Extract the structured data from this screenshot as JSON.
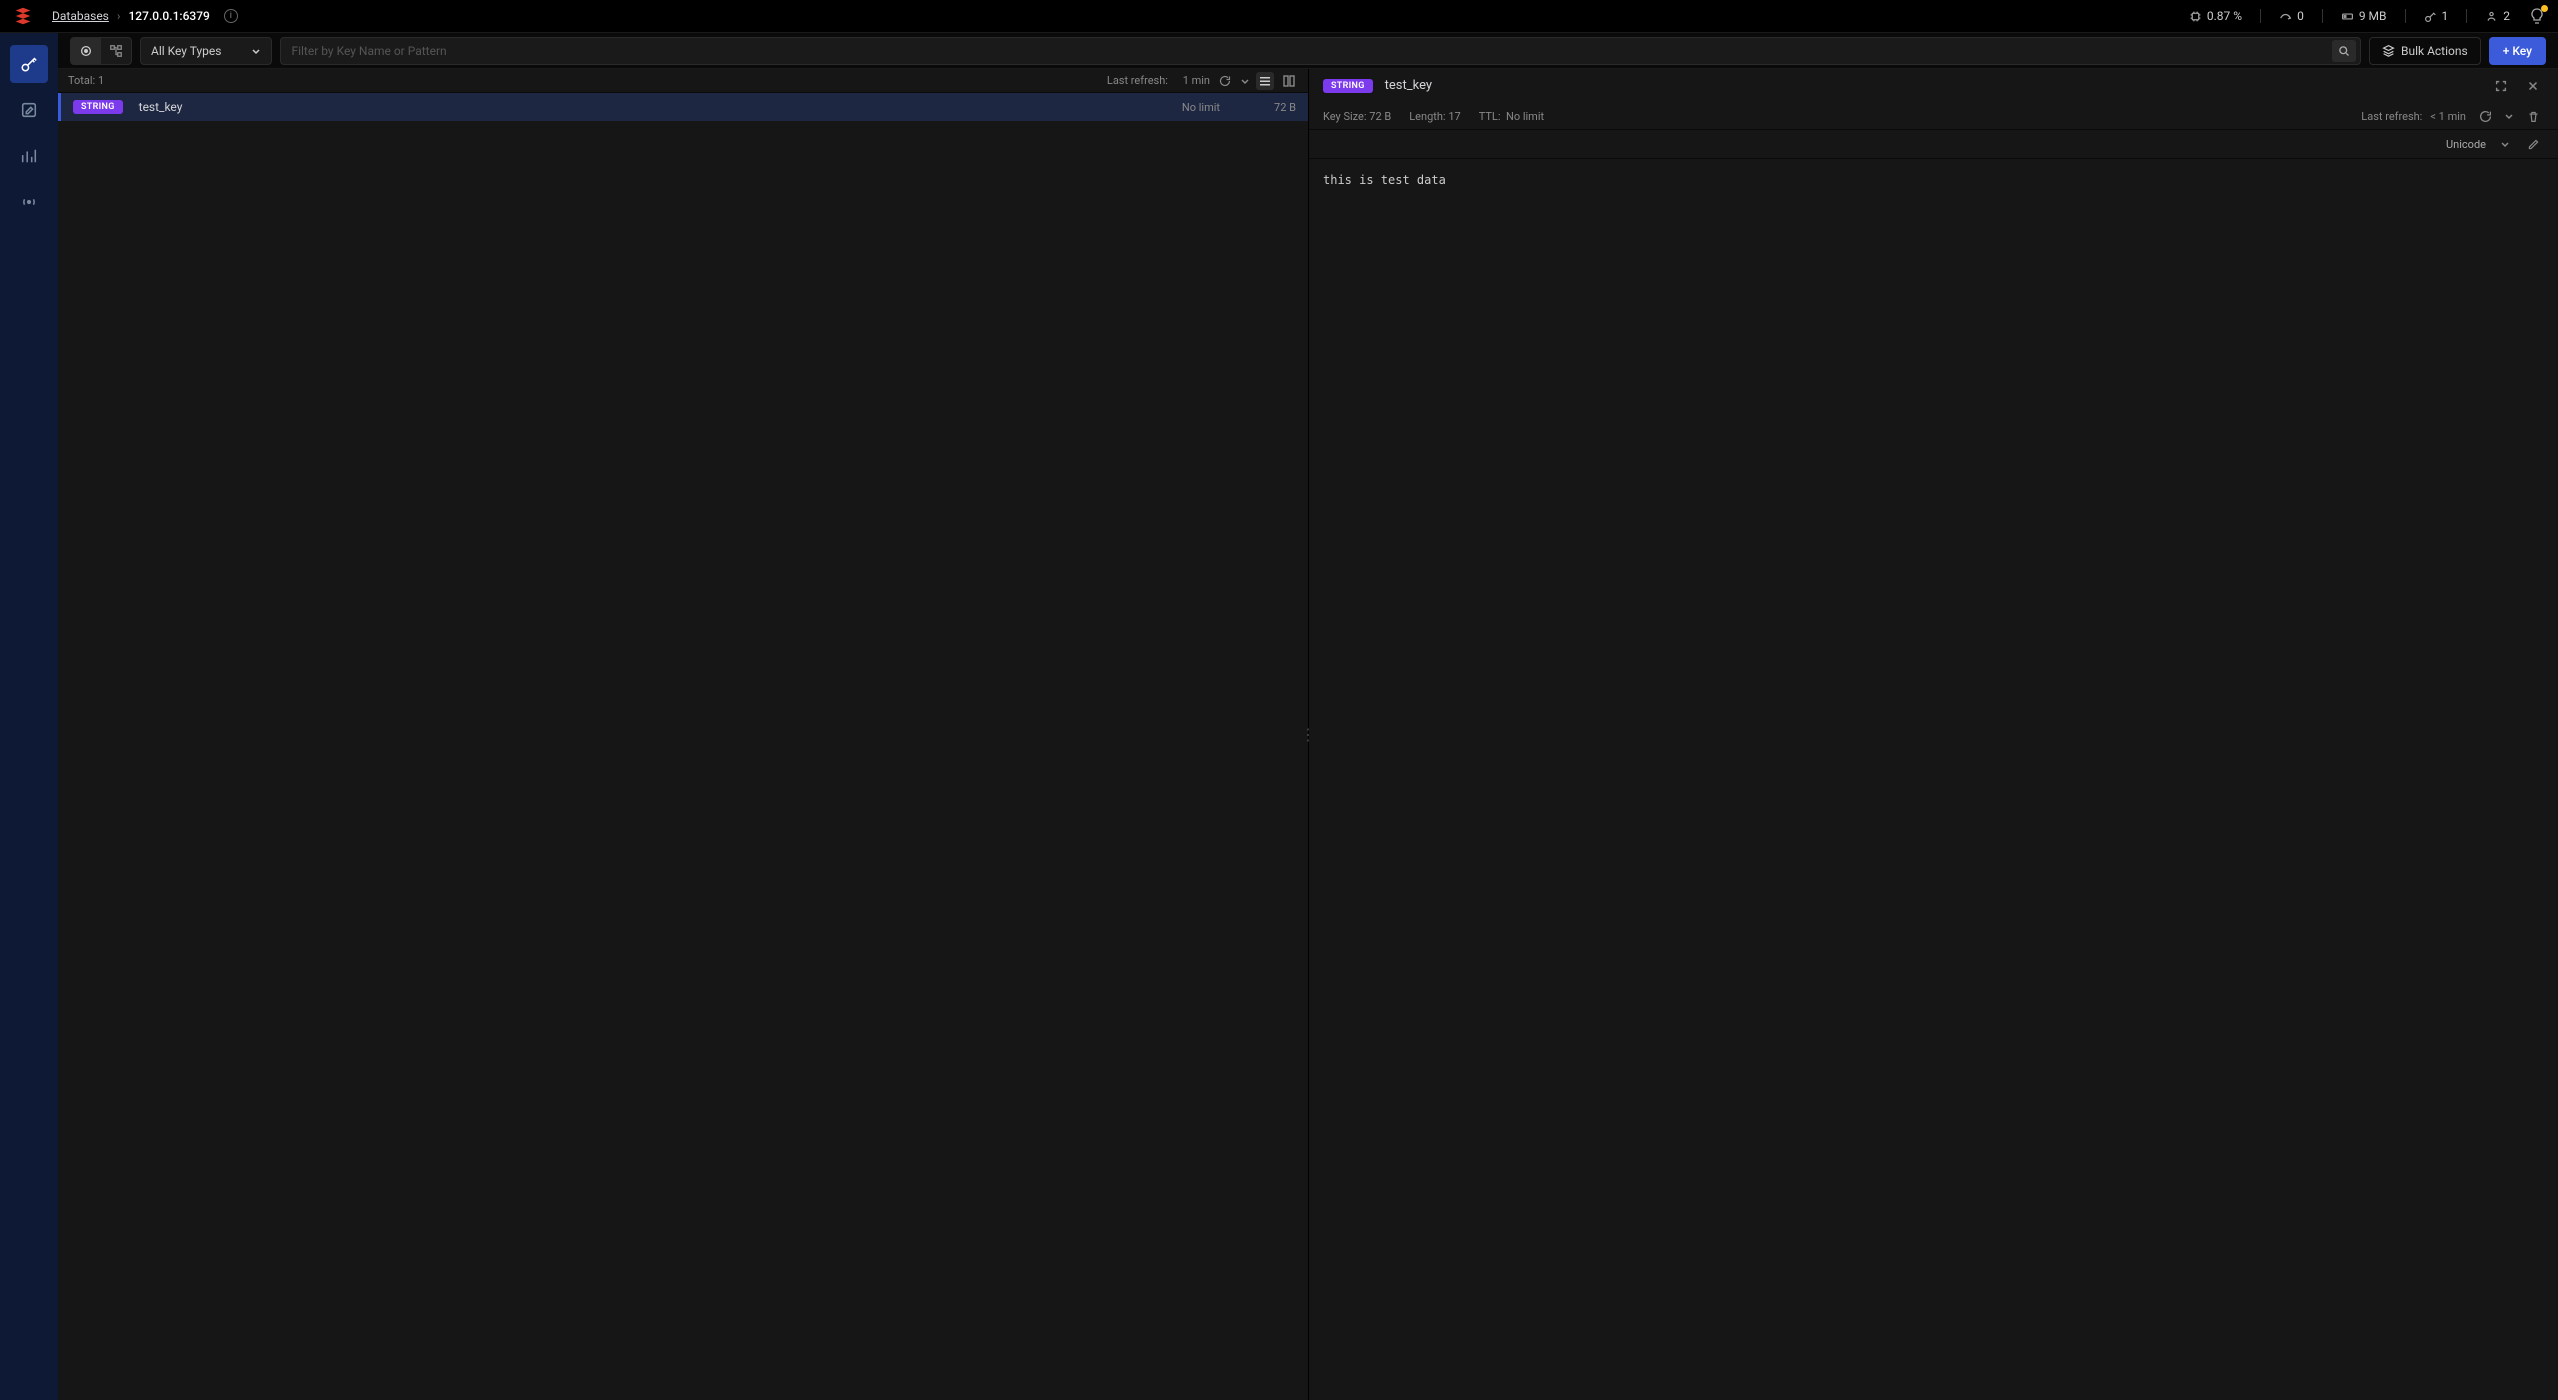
{
  "header": {
    "breadcrumb": {
      "root": "Databases",
      "current": "127.0.0.1:6379"
    },
    "stats": {
      "cpu": "0.87 %",
      "commands": "0",
      "memory": "9 MB",
      "keys": "1",
      "connections": "2"
    }
  },
  "toolbar": {
    "filter_type": "All Key Types",
    "search_placeholder": "Filter by Key Name or Pattern",
    "bulk": "Bulk Actions",
    "add_key": "+ Key"
  },
  "list": {
    "total_label": "Total:",
    "total_count": "1",
    "last_refresh_label": "Last refresh:",
    "last_refresh_value": "1 min",
    "rows": [
      {
        "type": "STRING",
        "name": "test_key",
        "ttl": "No limit",
        "size": "72 B"
      }
    ]
  },
  "detail": {
    "type": "STRING",
    "name": "test_key",
    "key_size_label": "Key Size:",
    "key_size_value": "72 B",
    "length_label": "Length:",
    "length_value": "17",
    "ttl_label": "TTL:",
    "ttl_value": "No limit",
    "last_refresh_label": "Last refresh:",
    "last_refresh_value": "< 1 min",
    "encoding": "Unicode",
    "value": "this is test data"
  }
}
